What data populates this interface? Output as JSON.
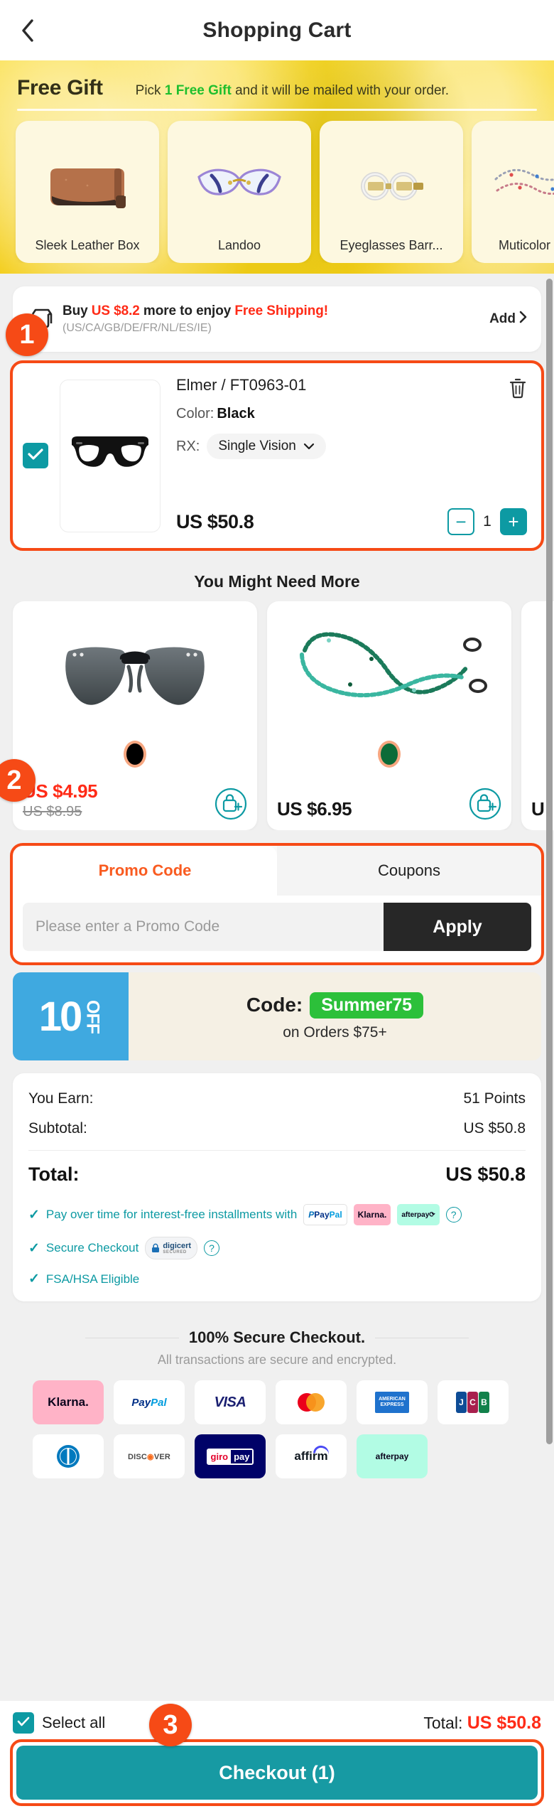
{
  "header": {
    "title": "Shopping Cart",
    "back_icon": "chevron-left-icon"
  },
  "gift_banner": {
    "title": "Free Gift",
    "subtitle_pre": "Pick ",
    "subtitle_em": "1 Free Gift",
    "subtitle_post": " and it will be mailed with your order.",
    "items": [
      {
        "label": "Sleek Leather Box",
        "icon": "leather-pouch-icon"
      },
      {
        "label": "Landoo",
        "icon": "cateye-glasses-icon"
      },
      {
        "label": "Eyeglasses Barr...",
        "icon": "hair-barrette-icon"
      },
      {
        "label": "Muticolor Cha...",
        "icon": "beaded-chain-icon"
      }
    ]
  },
  "shipping": {
    "icon": "shipping-box-icon",
    "line1_pre": "Buy ",
    "line1_amount": "US $8.2",
    "line1_mid": " more to enjoy ",
    "line1_em": "Free Shipping!",
    "line2": "(US/CA/GB/DE/FR/NL/ES/IE)",
    "add_label": "Add",
    "add_chevron": "chevron-right-icon"
  },
  "steps": {
    "one": "1",
    "two": "2",
    "three": "3"
  },
  "cart_item": {
    "checkbox_icon": "check-icon",
    "image_icon": "black-eyeglasses-icon",
    "title": "Elmer / FT0963-01",
    "color_label": "Color:",
    "color_value": "Black",
    "rx_label": "RX:",
    "rx_value": "Single Vision",
    "rx_chevron": "chevron-down-icon",
    "price": "US $50.8",
    "delete_icon": "trash-icon",
    "qty_minus": "−",
    "qty_value": "1",
    "qty_plus": "+"
  },
  "recommendations": {
    "title": "You Might Need More",
    "cards": [
      {
        "image_icon": "clip-on-sunglasses-icon",
        "swatch_color": "#000000",
        "price": "US $4.95",
        "price_old": "US $8.95",
        "price_color": "#ff2b17",
        "add_icon": "add-to-cart-icon"
      },
      {
        "image_icon": "eyeglass-chain-icon",
        "swatch_color": "#0c6b38",
        "price": "US $6.95",
        "price_old": "",
        "price_color": "#161616",
        "add_icon": "add-to-cart-icon"
      },
      {
        "image_icon": "partial-product-icon",
        "swatch_color": "",
        "price": "U",
        "price_old": "",
        "price_color": "#161616",
        "add_icon": "add-to-cart-icon"
      }
    ]
  },
  "promo": {
    "tabs": [
      {
        "label": "Promo Code",
        "active": true
      },
      {
        "label": "Coupons",
        "active": false
      }
    ],
    "placeholder": "Please enter a Promo Code",
    "value": "",
    "apply_label": "Apply"
  },
  "coupon": {
    "amount": "10",
    "off_label": "OFF",
    "code_label": "Code:",
    "code_value": "Summer75",
    "condition": "on Orders $75+"
  },
  "summary": {
    "rows": [
      {
        "label": "You Earn:",
        "value": "51 Points"
      },
      {
        "label": "Subtotal:",
        "value": "US $50.8"
      }
    ],
    "total_label": "Total:",
    "total_value": "US $50.8",
    "perks": [
      {
        "text": "Pay over time for interest-free installments with",
        "brands": [
          "PayPal",
          "Klarna.",
          "afterpay"
        ],
        "help": "?"
      },
      {
        "text": "Secure Checkout",
        "badge": "digicert SECURED",
        "help": "?"
      },
      {
        "text": "FSA/HSA Eligible",
        "badge": "",
        "help": ""
      }
    ]
  },
  "secure_footer": {
    "title": "100% Secure Checkout.",
    "subtitle": "All transactions are secure and encrypted.",
    "logos": [
      {
        "name": "Klarna.",
        "key": "klarna"
      },
      {
        "name": "PayPal",
        "key": "paypal"
      },
      {
        "name": "VISA",
        "key": "visa"
      },
      {
        "name": "Mastercard",
        "key": "mastercard"
      },
      {
        "name": "AMERICAN EXPRESS",
        "key": "amex"
      },
      {
        "name": "JCB",
        "key": "jcb"
      },
      {
        "name": "Diners Club",
        "key": "diners"
      },
      {
        "name": "DISCOVER",
        "key": "discover"
      },
      {
        "name": "giropay",
        "key": "giropay"
      },
      {
        "name": "affirm",
        "key": "affirm"
      },
      {
        "name": "afterpay",
        "key": "afterpay"
      }
    ]
  },
  "bottom_bar": {
    "select_all_label": "Select all",
    "select_all_checked": true,
    "total_label": "Total:",
    "total_value": "US $50.8",
    "checkout_label": "Checkout (1)"
  },
  "colors": {
    "accent_teal": "#0d9aa3",
    "accent_orange": "#f64a16",
    "red": "#ff2b17",
    "banner_yellow": "#f7d41c",
    "green": "#2cc03a"
  }
}
